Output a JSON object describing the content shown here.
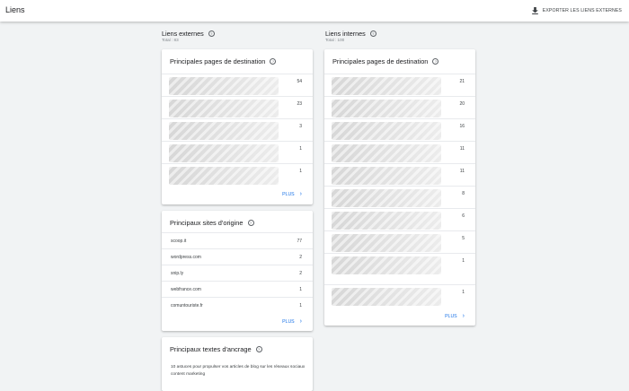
{
  "header": {
    "title": "Liens",
    "export_label": "EXPORTER LES LIENS EXTERNES"
  },
  "external": {
    "title": "Liens externes",
    "total": "Total : 83",
    "top_pages": {
      "title": "Principales pages de destination",
      "values": [
        "54",
        "23",
        "3",
        "1",
        "1"
      ],
      "more": "PLUS"
    },
    "top_sites": {
      "title": "Principaux sites d'origine",
      "rows": [
        {
          "site": "scoop.it",
          "count": "77"
        },
        {
          "site": "wordpress.com",
          "count": "2"
        },
        {
          "site": "snip.ly",
          "count": "2"
        },
        {
          "site": "webfrance.com",
          "count": "1"
        },
        {
          "site": "comuntouriste.fr",
          "count": "1"
        }
      ],
      "more": "PLUS"
    },
    "anchor": {
      "title": "Principaux textes d'ancrage",
      "first_text": "10 astuces pour propulser vos articles de blog sur les réseaux sociaux content marketing"
    }
  },
  "internal": {
    "title": "Liens internes",
    "total": "Total : 100",
    "top_pages": {
      "title": "Principales pages de destination",
      "values": [
        "21",
        "20",
        "16",
        "11",
        "11",
        "8",
        "6",
        "5",
        "1",
        "1"
      ],
      "more": "PLUS"
    }
  }
}
